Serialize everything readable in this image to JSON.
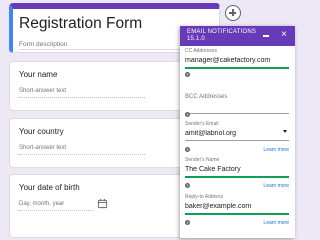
{
  "form": {
    "title": "Registration Form",
    "description": "Form description",
    "questions": [
      {
        "label": "Your name",
        "placeholder": "Short-answer text"
      },
      {
        "label": "Your country",
        "placeholder": "Short-answer text"
      },
      {
        "label": "Your date of birth",
        "placeholder": "Day, month, year"
      }
    ]
  },
  "panel": {
    "title_line1": "EMAIL NOTIFICATIONS",
    "title_line2": "15.1.0",
    "minimize_icon": "minimize-icon",
    "close_icon": "×",
    "cc": {
      "label": "CC Addresses",
      "value": "manager@cakefactory.com"
    },
    "bcc": {
      "label": "BCC Addresses",
      "value": ""
    },
    "sender_email": {
      "label": "Sender's Email",
      "value": "amit@labnol.org",
      "learn_more": "Learn more"
    },
    "sender_name": {
      "label": "Sender's Name",
      "value": "The Cake Factory",
      "learn_more": "Learn more"
    },
    "reply_to": {
      "label": "Reply-to Address",
      "value": "baker@example.com",
      "learn_more": "Learn more"
    }
  },
  "colors": {
    "accent": "#673ab7",
    "active_line": "#0f9d58",
    "link": "#1a73e8"
  }
}
